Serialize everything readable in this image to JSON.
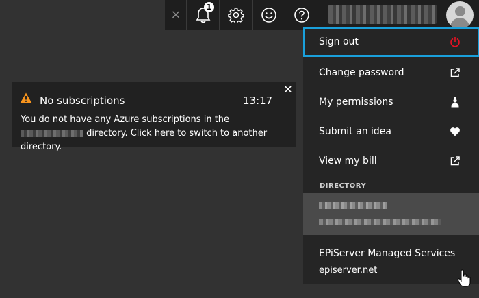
{
  "topbar": {
    "close_glyph": "×",
    "notifications_count": "1",
    "buttons": [
      "bell-icon",
      "gear-icon",
      "smiley-icon",
      "help-icon"
    ]
  },
  "toast": {
    "title": "No subscriptions",
    "time": "13:17",
    "message_part1": "You do not have any Azure subscriptions in the",
    "message_part2": "directory. Click here to switch to another directory.",
    "close_glyph": "✕"
  },
  "menu": {
    "items": [
      {
        "label": "Sign out",
        "icon": "power-icon",
        "icon_color": "#e81123"
      },
      {
        "label": "Change password",
        "icon": "external-link-icon"
      },
      {
        "label": "My permissions",
        "icon": "person-badge-icon"
      },
      {
        "label": "Submit an idea",
        "icon": "heart-icon"
      },
      {
        "label": "View my bill",
        "icon": "external-link-icon"
      }
    ],
    "directory_heading": "DIRECTORY",
    "directories": [
      {
        "name": "EPiServer Managed Services",
        "domain": "episerver.net"
      }
    ]
  },
  "colors": {
    "background": "#323232",
    "topbar": "#1e1e1e",
    "menu": "#252525",
    "focus_border": "#1aa0db",
    "warning": "#f7941d"
  }
}
